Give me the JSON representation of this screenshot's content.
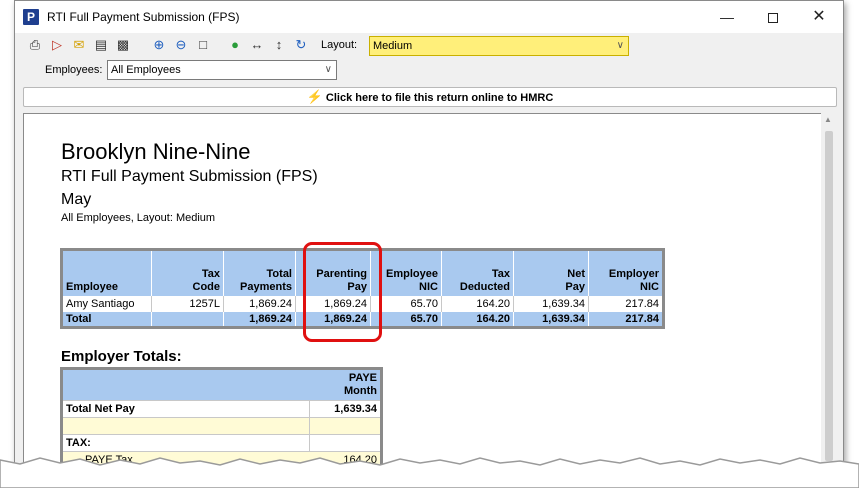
{
  "window": {
    "title": "RTI Full Payment Submission (FPS)",
    "app_icon": "P"
  },
  "toolbar": {
    "layout_label": "Layout:",
    "layout_value": "Medium",
    "employees_label": "Employees:",
    "employees_value": "All Employees",
    "icons": [
      "print-icon",
      "pdf-icon",
      "email-icon",
      "clipboard-icon",
      "save-icon",
      "zoom-in-icon",
      "zoom-out-icon",
      "page-icon",
      "color-icon",
      "fit-width-icon",
      "fit-height-icon",
      "refresh-icon"
    ]
  },
  "file_bar": {
    "label": "Click here to file this return online to HMRC"
  },
  "report": {
    "company": "Brooklyn Nine-Nine",
    "subtitle": "RTI Full Payment Submission (FPS)",
    "month": "May",
    "filter": "All Employees, Layout: Medium",
    "columns": [
      [
        "Employee",
        ""
      ],
      [
        "Tax",
        "Code"
      ],
      [
        "Total",
        "Payments"
      ],
      [
        "Parenting",
        "Pay"
      ],
      [
        "Employee",
        "NIC"
      ],
      [
        "Tax",
        "Deducted"
      ],
      [
        "Net",
        "Pay"
      ],
      [
        "Employer",
        "NIC"
      ]
    ],
    "rows": [
      [
        "Amy Santiago",
        "1257L",
        "1,869.24",
        "1,869.24",
        "65.70",
        "164.20",
        "1,639.34",
        "217.84"
      ]
    ],
    "total": [
      "Total",
      "",
      "1,869.24",
      "1,869.24",
      "65.70",
      "164.20",
      "1,639.34",
      "217.84"
    ],
    "employer_totals": {
      "heading": "Employer Totals:",
      "col_header": [
        "PAYE",
        "Month"
      ],
      "rows": [
        {
          "label": "Total Net Pay",
          "value": "1,639.34"
        },
        {
          "label": "",
          "value": ""
        },
        {
          "label": "TAX:",
          "value": ""
        },
        {
          "label": "PAYE Tax",
          "value": "164.20"
        }
      ]
    }
  },
  "colors": {
    "header_blue": "#a9c9ef",
    "highlight_red": "#e01010",
    "layout_yellow": "#ffef7a"
  }
}
